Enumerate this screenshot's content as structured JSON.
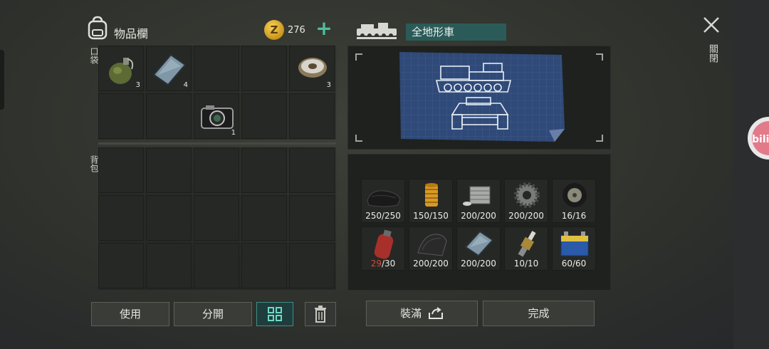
{
  "inventory": {
    "title": "物品欄",
    "pockets_label": "口袋",
    "backpack_label": "背包",
    "coins": "276",
    "pocket_items": [
      {
        "icon": "grenade-icon",
        "qty": "3"
      },
      {
        "icon": "metal-plate-icon",
        "qty": "4"
      },
      {
        "icon": "",
        "qty": ""
      },
      {
        "icon": "",
        "qty": ""
      },
      {
        "icon": "wire-spool-icon",
        "qty": "3"
      },
      {
        "icon": "",
        "qty": ""
      },
      {
        "icon": "",
        "qty": ""
      },
      {
        "icon": "camera-icon",
        "qty": "1"
      },
      {
        "icon": "",
        "qty": ""
      },
      {
        "icon": "",
        "qty": ""
      }
    ]
  },
  "buttons": {
    "use": "使用",
    "split": "分開",
    "fill": "裝滿",
    "done": "完成"
  },
  "vehicle": {
    "name": "全地形車",
    "parts": [
      {
        "icon": "tarp-icon",
        "current": "250",
        "max": "250",
        "low": false
      },
      {
        "icon": "oil-filter-icon",
        "current": "150",
        "max": "150",
        "low": false
      },
      {
        "icon": "engine-block-icon",
        "current": "200",
        "max": "200",
        "low": false
      },
      {
        "icon": "gear-icon",
        "current": "200",
        "max": "200",
        "low": false
      },
      {
        "icon": "wheel-icon",
        "current": "16",
        "max": "16",
        "low": false
      },
      {
        "icon": "gas-cylinder-icon",
        "current": "29",
        "max": "30",
        "low": true
      },
      {
        "icon": "carbon-sheet-icon",
        "current": "200",
        "max": "200",
        "low": false
      },
      {
        "icon": "metal-plate-icon",
        "current": "200",
        "max": "200",
        "low": false
      },
      {
        "icon": "spark-plug-icon",
        "current": "10",
        "max": "10",
        "low": false
      },
      {
        "icon": "car-battery-icon",
        "current": "60",
        "max": "60",
        "low": false
      }
    ]
  },
  "close_label": "關閉",
  "colors": {
    "accent": "#4dbfa0",
    "name_bg": "#2b5b58",
    "warning": "#d44a3a",
    "blueprint": "#2f4a78"
  }
}
